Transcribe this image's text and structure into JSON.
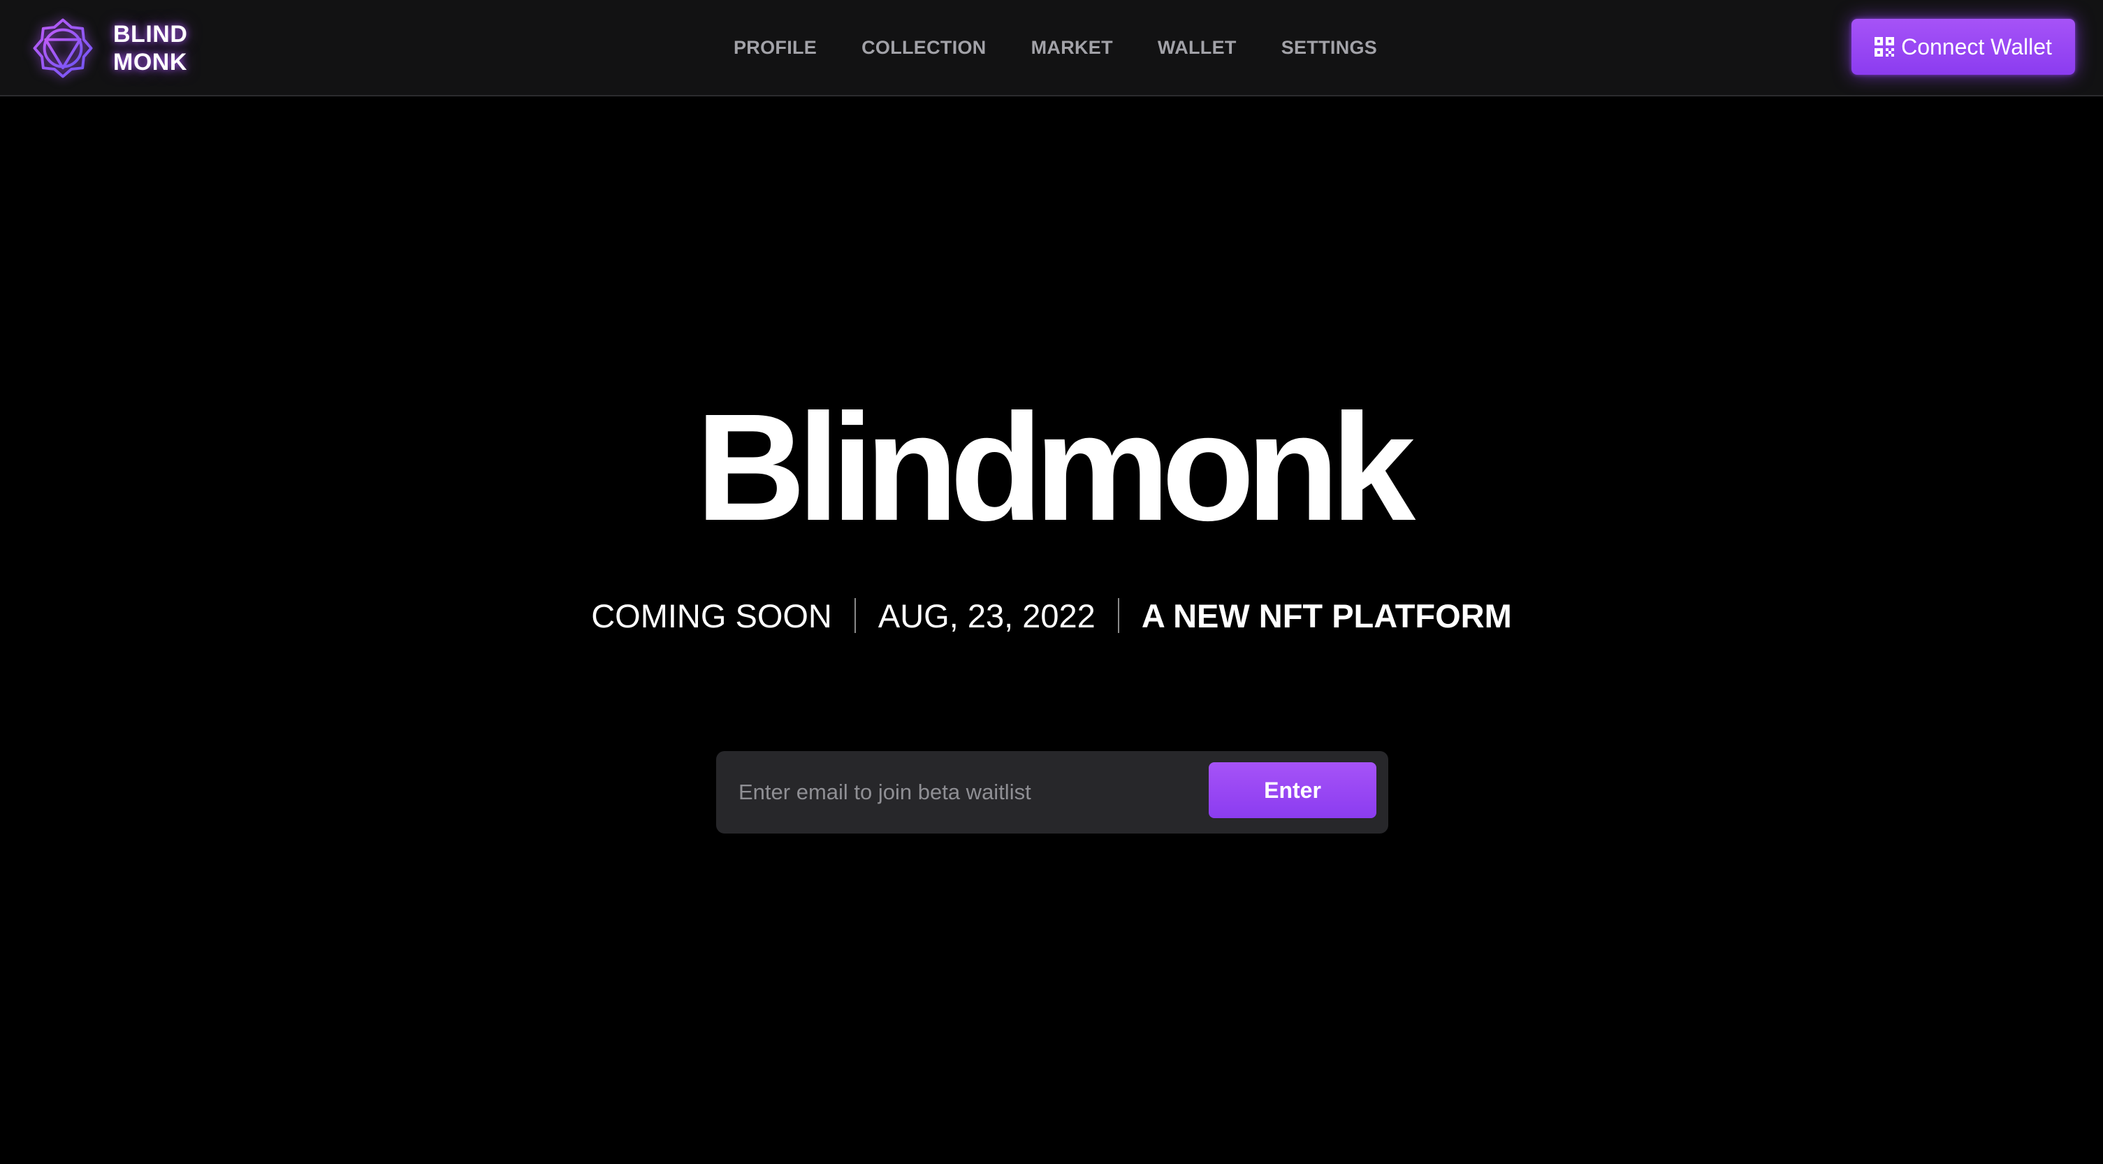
{
  "colors": {
    "background": "#000000",
    "header_background": "#121213",
    "accent": "#9b4bf5",
    "nav_text": "#a2a2a8",
    "input_background": "#27272a"
  },
  "brand": {
    "logo_icon": "hexagram-logo-icon",
    "name_line1": "BLIND",
    "name_line2": "MONK"
  },
  "nav": {
    "items": [
      {
        "label": "PROFILE"
      },
      {
        "label": "COLLECTION"
      },
      {
        "label": "MARKET"
      },
      {
        "label": "WALLET"
      },
      {
        "label": "SETTINGS"
      }
    ]
  },
  "header": {
    "connect_wallet_icon": "qr-code-icon",
    "connect_wallet_label": "Connect Wallet"
  },
  "hero": {
    "title": "Blindmonk",
    "tagline": {
      "status": "COMING SOON",
      "date": "AUG, 23, 2022",
      "description": "A NEW NFT PLATFORM"
    }
  },
  "waitlist": {
    "email_placeholder": "Enter email to join beta waitlist",
    "email_value": "",
    "submit_label": "Enter"
  }
}
